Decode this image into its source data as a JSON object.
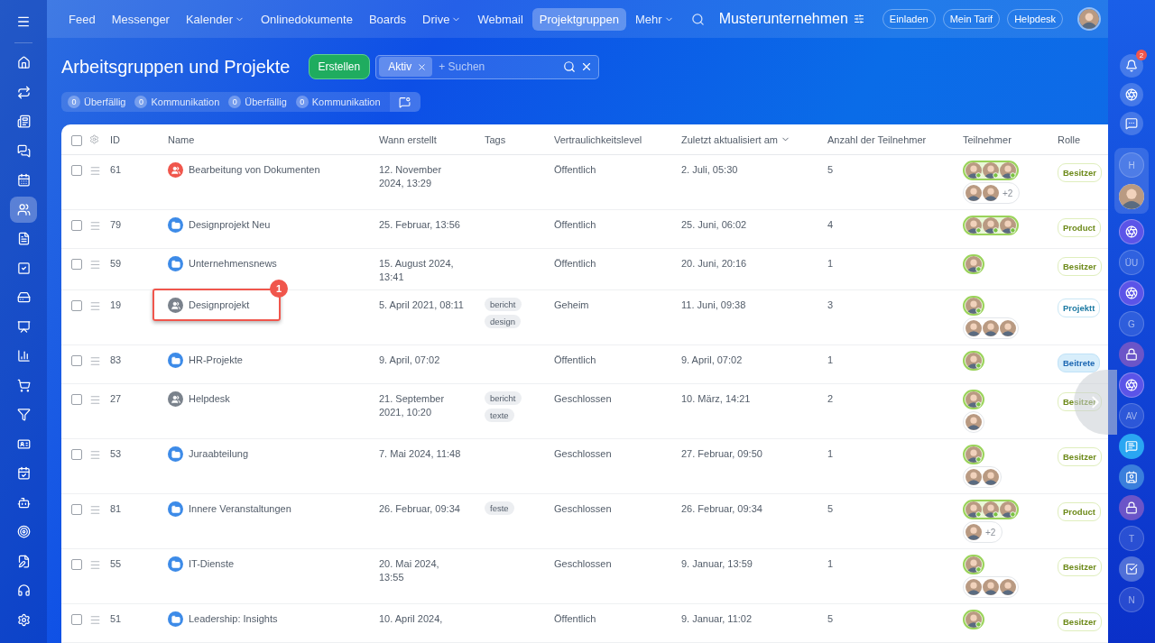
{
  "sidebar": {
    "items": [
      {
        "selected": false
      },
      {
        "selected": false
      },
      {
        "selected": false
      },
      {
        "selected": false
      },
      {
        "selected": false
      },
      {
        "selected": true
      },
      {
        "selected": false
      },
      {
        "selected": false
      },
      {
        "selected": false
      },
      {
        "selected": false
      },
      {
        "selected": false
      },
      {
        "selected": false
      },
      {
        "selected": false
      },
      {
        "selected": false
      },
      {
        "selected": false
      },
      {
        "selected": false
      },
      {
        "selected": false
      },
      {
        "selected": false
      },
      {
        "selected": false
      },
      {
        "selected": false
      }
    ]
  },
  "top_nav": {
    "items": [
      {
        "label": "Feed",
        "selected": false,
        "dropdown": false
      },
      {
        "label": "Messenger",
        "selected": false,
        "dropdown": false
      },
      {
        "label": "Kalender",
        "selected": false,
        "dropdown": true
      },
      {
        "label": "Onlinedokumente",
        "selected": false,
        "dropdown": false
      },
      {
        "label": "Boards",
        "selected": false,
        "dropdown": false
      },
      {
        "label": "Drive",
        "selected": false,
        "dropdown": true
      },
      {
        "label": "Webmail",
        "selected": false,
        "dropdown": false
      },
      {
        "label": "Projektgruppen",
        "selected": true,
        "dropdown": false
      },
      {
        "label": "Mehr",
        "selected": false,
        "dropdown": true
      }
    ],
    "company": "Musterunternehmen",
    "buttons": [
      "Einladen",
      "Mein Tarif",
      "Helpdesk"
    ]
  },
  "header": {
    "title": "Arbeitsgruppen und Projekte",
    "create_button": "Erstellen",
    "search": {
      "chip": "Aktiv",
      "placeholder": "+ Suchen"
    },
    "counters": [
      {
        "count": "0",
        "label": "Überfällig"
      },
      {
        "count": "0",
        "label": "Kommunikation"
      },
      {
        "count": "0",
        "label": "Überfällig"
      },
      {
        "count": "0",
        "label": "Kommunikation"
      }
    ]
  },
  "table": {
    "all_checked": false,
    "columns": [
      {
        "label": "ID",
        "sorted": false
      },
      {
        "label": "Name",
        "sorted": false
      },
      {
        "label": "Wann erstellt",
        "sorted": false
      },
      {
        "label": "Tags",
        "sorted": false
      },
      {
        "label": "Vertraulichkeitslevel",
        "sorted": false
      },
      {
        "label": "Zuletzt aktualisiert am",
        "sorted": true
      },
      {
        "label": "Anzahl der Teilnehmer",
        "sorted": false
      },
      {
        "label": "Teilnehmer",
        "sorted": false
      },
      {
        "label": "Rolle",
        "sorted": false
      }
    ],
    "rows": [
      {
        "checked": false,
        "highlighted": false,
        "id": "61",
        "kind": "team",
        "name": "Bearbeitung von Dokumenten",
        "created": "12. November 2024, 13:29",
        "tags": [],
        "privacy": "Öffentlich",
        "updated": "2. Juli, 05:30",
        "count": "5",
        "participants": [
          {
            "kind": "owners",
            "avatars": [
              {
                "online": true
              },
              {
                "online": true
              },
              {
                "online": true
              }
            ]
          },
          {
            "kind": "members",
            "avatars": [
              {
                "online": false
              },
              {
                "online": false
              }
            ],
            "more": "+2"
          }
        ],
        "role": {
          "kind": "owner",
          "label": "Besitzer"
        }
      },
      {
        "checked": false,
        "highlighted": false,
        "id": "79",
        "kind": "project",
        "name": "Designprojekt Neu",
        "created": "25. Februar, 13:56",
        "tags": [],
        "privacy": "Öffentlich",
        "updated": "25. Juni, 06:02",
        "count": "4",
        "participants": [
          {
            "kind": "owners",
            "avatars": [
              {
                "online": true
              },
              {
                "online": true
              },
              {
                "online": true
              }
            ]
          }
        ],
        "role": {
          "kind": "owner",
          "label": "Product"
        }
      },
      {
        "checked": false,
        "highlighted": false,
        "id": "59",
        "kind": "project",
        "name": "Unternehmensnews",
        "created": "15. August 2024, 13:41",
        "tags": [],
        "privacy": "Öffentlich",
        "updated": "20. Juni, 20:16",
        "count": "1",
        "participants": [
          {
            "kind": "owners",
            "avatars": [
              {
                "online": true
              }
            ]
          }
        ],
        "role": {
          "kind": "owner",
          "label": "Besitzer"
        }
      },
      {
        "checked": false,
        "highlighted": true,
        "callout": "1",
        "id": "19",
        "kind": "group",
        "name": "Designprojekt",
        "created": "5. April 2021, 08:11",
        "tags": [
          "bericht",
          "design"
        ],
        "privacy": "Geheim",
        "updated": "11. Juni, 09:38",
        "count": "3",
        "participants": [
          {
            "kind": "owners",
            "avatars": [
              {
                "online": true
              }
            ]
          },
          {
            "kind": "members",
            "avatars": [
              {
                "online": false
              },
              {
                "online": false
              },
              {
                "online": false
              }
            ]
          }
        ],
        "role": {
          "kind": "moderator",
          "label": "Projektt"
        }
      },
      {
        "checked": false,
        "highlighted": false,
        "id": "83",
        "kind": "project",
        "name": "HR-Projekte",
        "created": "9. April, 07:02",
        "tags": [],
        "privacy": "Öffentlich",
        "updated": "9. April, 07:02",
        "count": "1",
        "participants": [
          {
            "kind": "owners",
            "avatars": [
              {
                "online": true
              }
            ]
          }
        ],
        "role": {
          "kind": "member",
          "label": "Beitrete"
        }
      },
      {
        "checked": false,
        "highlighted": false,
        "id": "27",
        "kind": "group",
        "name": "Helpdesk",
        "created": "21. September 2021, 10:20",
        "tags": [
          "bericht",
          "texte"
        ],
        "privacy": "Geschlossen",
        "updated": "10. März, 14:21",
        "count": "2",
        "participants": [
          {
            "kind": "owners",
            "avatars": [
              {
                "online": true
              }
            ]
          },
          {
            "kind": "members",
            "avatars": [
              {
                "online": false
              }
            ]
          }
        ],
        "role": {
          "kind": "owner",
          "label": "Besitzer"
        }
      },
      {
        "checked": false,
        "highlighted": false,
        "id": "53",
        "kind": "project",
        "name": "Juraabteilung",
        "created": "7. Mai 2024, 11:48",
        "tags": [],
        "privacy": "Geschlossen",
        "updated": "27. Februar, 09:50",
        "count": "1",
        "participants": [
          {
            "kind": "owners",
            "avatars": [
              {
                "online": true
              }
            ]
          },
          {
            "kind": "members",
            "avatars": [
              {
                "online": false
              },
              {
                "online": false
              }
            ]
          }
        ],
        "role": {
          "kind": "owner",
          "label": "Besitzer"
        }
      },
      {
        "checked": false,
        "highlighted": false,
        "id": "81",
        "kind": "project",
        "name": "Innere Veranstaltungen",
        "created": "26. Februar, 09:34",
        "tags": [
          "feste"
        ],
        "privacy": "Geschlossen",
        "updated": "26. Februar, 09:34",
        "count": "5",
        "participants": [
          {
            "kind": "owners",
            "avatars": [
              {
                "online": true
              },
              {
                "online": true
              },
              {
                "online": true
              }
            ]
          },
          {
            "kind": "members",
            "avatars": [
              {
                "online": false
              }
            ],
            "more": "+2"
          }
        ],
        "role": {
          "kind": "owner",
          "label": "Product"
        }
      },
      {
        "checked": false,
        "highlighted": false,
        "id": "55",
        "kind": "project",
        "name": "IT-Dienste",
        "created": "20. Mai 2024, 13:55",
        "tags": [],
        "privacy": "Geschlossen",
        "updated": "9. Januar, 13:59",
        "count": "1",
        "participants": [
          {
            "kind": "owners",
            "avatars": [
              {
                "online": true
              }
            ]
          },
          {
            "kind": "members",
            "avatars": [
              {
                "online": false
              },
              {
                "online": false
              },
              {
                "online": false
              }
            ]
          }
        ],
        "role": {
          "kind": "owner",
          "label": "Besitzer"
        }
      },
      {
        "checked": false,
        "highlighted": false,
        "id": "51",
        "kind": "project",
        "name": "Leadership: Insights",
        "created": "10. April 2024,",
        "tags": [],
        "privacy": "Öffentlich",
        "updated": "9. Januar, 11:02",
        "count": "5",
        "participants": [
          {
            "kind": "owners",
            "avatars": [
              {
                "online": true
              }
            ]
          }
        ],
        "role": {
          "kind": "owner",
          "label": "Besitzer"
        }
      }
    ]
  },
  "right_rail": {
    "notifications": "2",
    "items": [
      {
        "kind": "letter",
        "text": "H"
      },
      {
        "kind": "avatar"
      },
      {
        "kind": "copilot"
      },
      {
        "kind": "letter",
        "text": "ÜU"
      },
      {
        "kind": "copilot"
      },
      {
        "kind": "letter",
        "text": "G"
      },
      {
        "kind": "lock"
      },
      {
        "kind": "copilot"
      },
      {
        "kind": "letter",
        "text": "AV"
      },
      {
        "kind": "chat"
      },
      {
        "kind": "contact"
      },
      {
        "kind": "lock"
      },
      {
        "kind": "letter",
        "text": "T"
      },
      {
        "kind": "task"
      },
      {
        "kind": "letter",
        "text": "N"
      }
    ]
  }
}
